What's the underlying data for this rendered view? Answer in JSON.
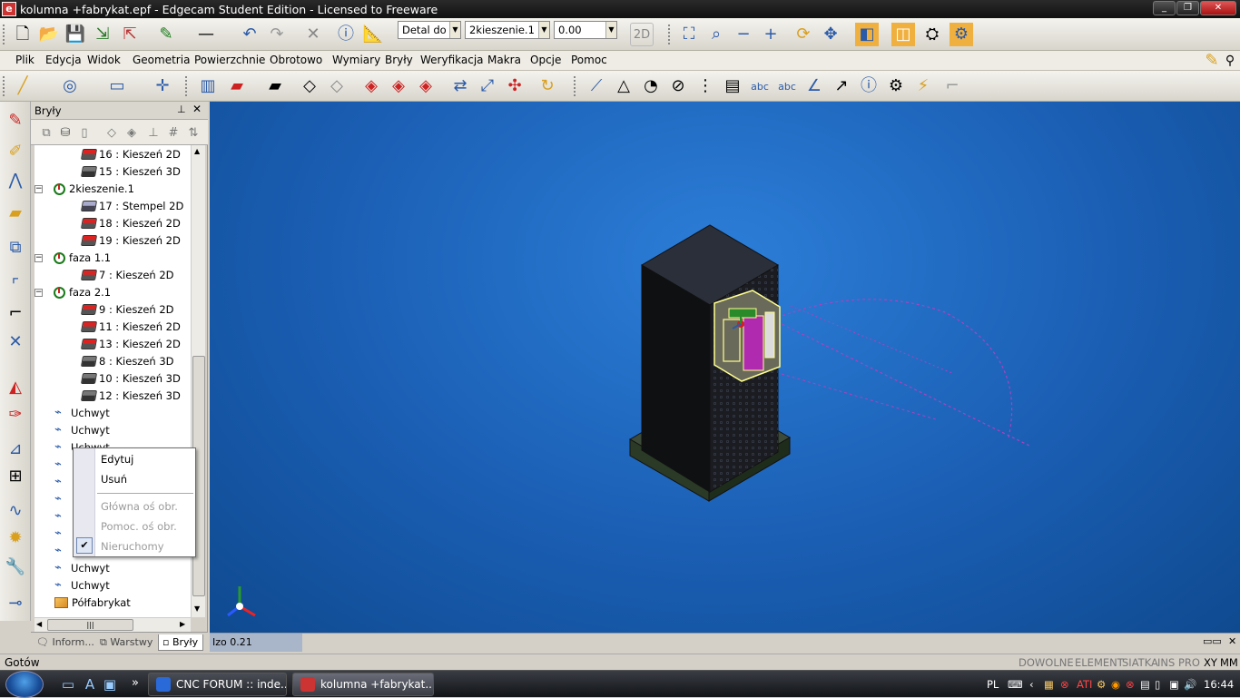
{
  "window": {
    "title": "kolumna +fabrykat.epf - Edgecam Student Edition - Licensed to Freeware"
  },
  "toolbar1": {
    "combo_detail": "Detal do c",
    "combo_op": "2kieszenie.1",
    "combo_value": "0.00",
    "view_2d": "2D"
  },
  "menu": [
    "Plik",
    "Edycja",
    "Widok",
    "Geometria",
    "Powierzchnie",
    "Obrotowo",
    "Wymiary",
    "Bryły",
    "Weryfikacja",
    "Makra",
    "Opcje",
    "Pomoc"
  ],
  "panel": {
    "title": "Bryły",
    "tree": [
      {
        "text": "16 :  Kieszeń 2D",
        "kind": "k2d"
      },
      {
        "text": "15 :  Kieszeń 3D",
        "kind": "k3d"
      },
      {
        "text": "2kieszenie.1",
        "kind": "op"
      },
      {
        "text": "17 :  Stempel 2D",
        "kind": "st"
      },
      {
        "text": "18 :  Kieszeń 2D",
        "kind": "k2d"
      },
      {
        "text": "19 :  Kieszeń 2D",
        "kind": "k2d"
      },
      {
        "text": "faza 1.1",
        "kind": "op"
      },
      {
        "text": "7 :  Kieszeń 2D",
        "kind": "k2d"
      },
      {
        "text": "faza 2.1",
        "kind": "op"
      },
      {
        "text": "9 :  Kieszeń 2D",
        "kind": "k2d"
      },
      {
        "text": "11 :  Kieszeń 2D",
        "kind": "k2d"
      },
      {
        "text": "13 :  Kieszeń 2D",
        "kind": "k2d"
      },
      {
        "text": "8 :  Kieszeń 3D",
        "kind": "k3d"
      },
      {
        "text": "10 :  Kieszeń 3D",
        "kind": "k3d"
      },
      {
        "text": "12 :  Kieszeń 3D",
        "kind": "k3d"
      },
      {
        "text": "Uchwyt",
        "kind": "uh"
      },
      {
        "text": "Uchwyt",
        "kind": "uh"
      },
      {
        "text": "Uchwyt",
        "kind": "uh"
      },
      {
        "text": "",
        "kind": "uh"
      },
      {
        "text": "",
        "kind": "uh"
      },
      {
        "text": "",
        "kind": "uh"
      },
      {
        "text": "",
        "kind": "uh"
      },
      {
        "text": "",
        "kind": "uh"
      },
      {
        "text": "",
        "kind": "uh"
      },
      {
        "text": "Uchwyt",
        "kind": "uh"
      },
      {
        "text": "Uchwyt",
        "kind": "uh"
      },
      {
        "text": "Półfabrykat",
        "kind": "pf"
      }
    ],
    "tabs": [
      "Inform...",
      "Warstwy",
      "Bryły"
    ]
  },
  "context_menu": {
    "edit": "Edytuj",
    "delete": "Usuń",
    "main_axis": "Główna oś obr.",
    "aux_axis": "Pomoc. oś obr.",
    "fixed": "Nieruchomy"
  },
  "viewport": {
    "view_label": "Izo 0.21"
  },
  "status": {
    "text": "Gotów",
    "indicators": [
      "DOWOLNE",
      "ELEMENT",
      "SIATKA",
      "INS",
      "PRO",
      "XY",
      "MM"
    ]
  },
  "taskbar": {
    "items": [
      "CNC FORUM :: inde...",
      "kolumna +fabrykat...."
    ],
    "lang": "PL",
    "clock": "16:44"
  },
  "colors": {
    "viewport_bg": "#1a5eb3",
    "accent": "#c33"
  }
}
